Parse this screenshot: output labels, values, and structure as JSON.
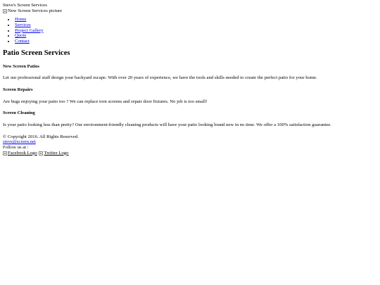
{
  "header": {
    "site_title": "Steve's Screen Services",
    "hero_img_alt": "New Screen Services picture"
  },
  "nav": {
    "items": [
      {
        "label": "Home"
      },
      {
        "label": "Services"
      },
      {
        "label": "Project Gallery"
      },
      {
        "label": "Quote"
      },
      {
        "label": "Contact"
      }
    ]
  },
  "main": {
    "heading": "Patio Screen Services",
    "sections": [
      {
        "title": "New Screen Patios",
        "text": "Let our professional staff design your backyard escape. With over 20 years of experience, we have the tools and skills needed to create the perfect patio for your home."
      },
      {
        "title": "Screen Repairs",
        "text": "Are bugs enjoying your patio too ? We can replace torn screens and repair door fixtures. No job is too small!"
      },
      {
        "title": "Screen Cleaning",
        "text": "Is your patio looking less than pretty? Our environment-friendly cleaning products will have your patio looking brand new in no time. We offer a 100% satisfaction guarantee."
      }
    ]
  },
  "footer": {
    "copyright": "© Copyright 2016. All Rights Reserved.",
    "email": "steve@screen.net",
    "follow_label": "Follow us at :",
    "facebook_alt": "Facebook Logo",
    "twitter_alt": "Twitter Logo"
  },
  "colors": {
    "link": "#0000ee",
    "text": "#000000",
    "background": "#ffffff"
  }
}
